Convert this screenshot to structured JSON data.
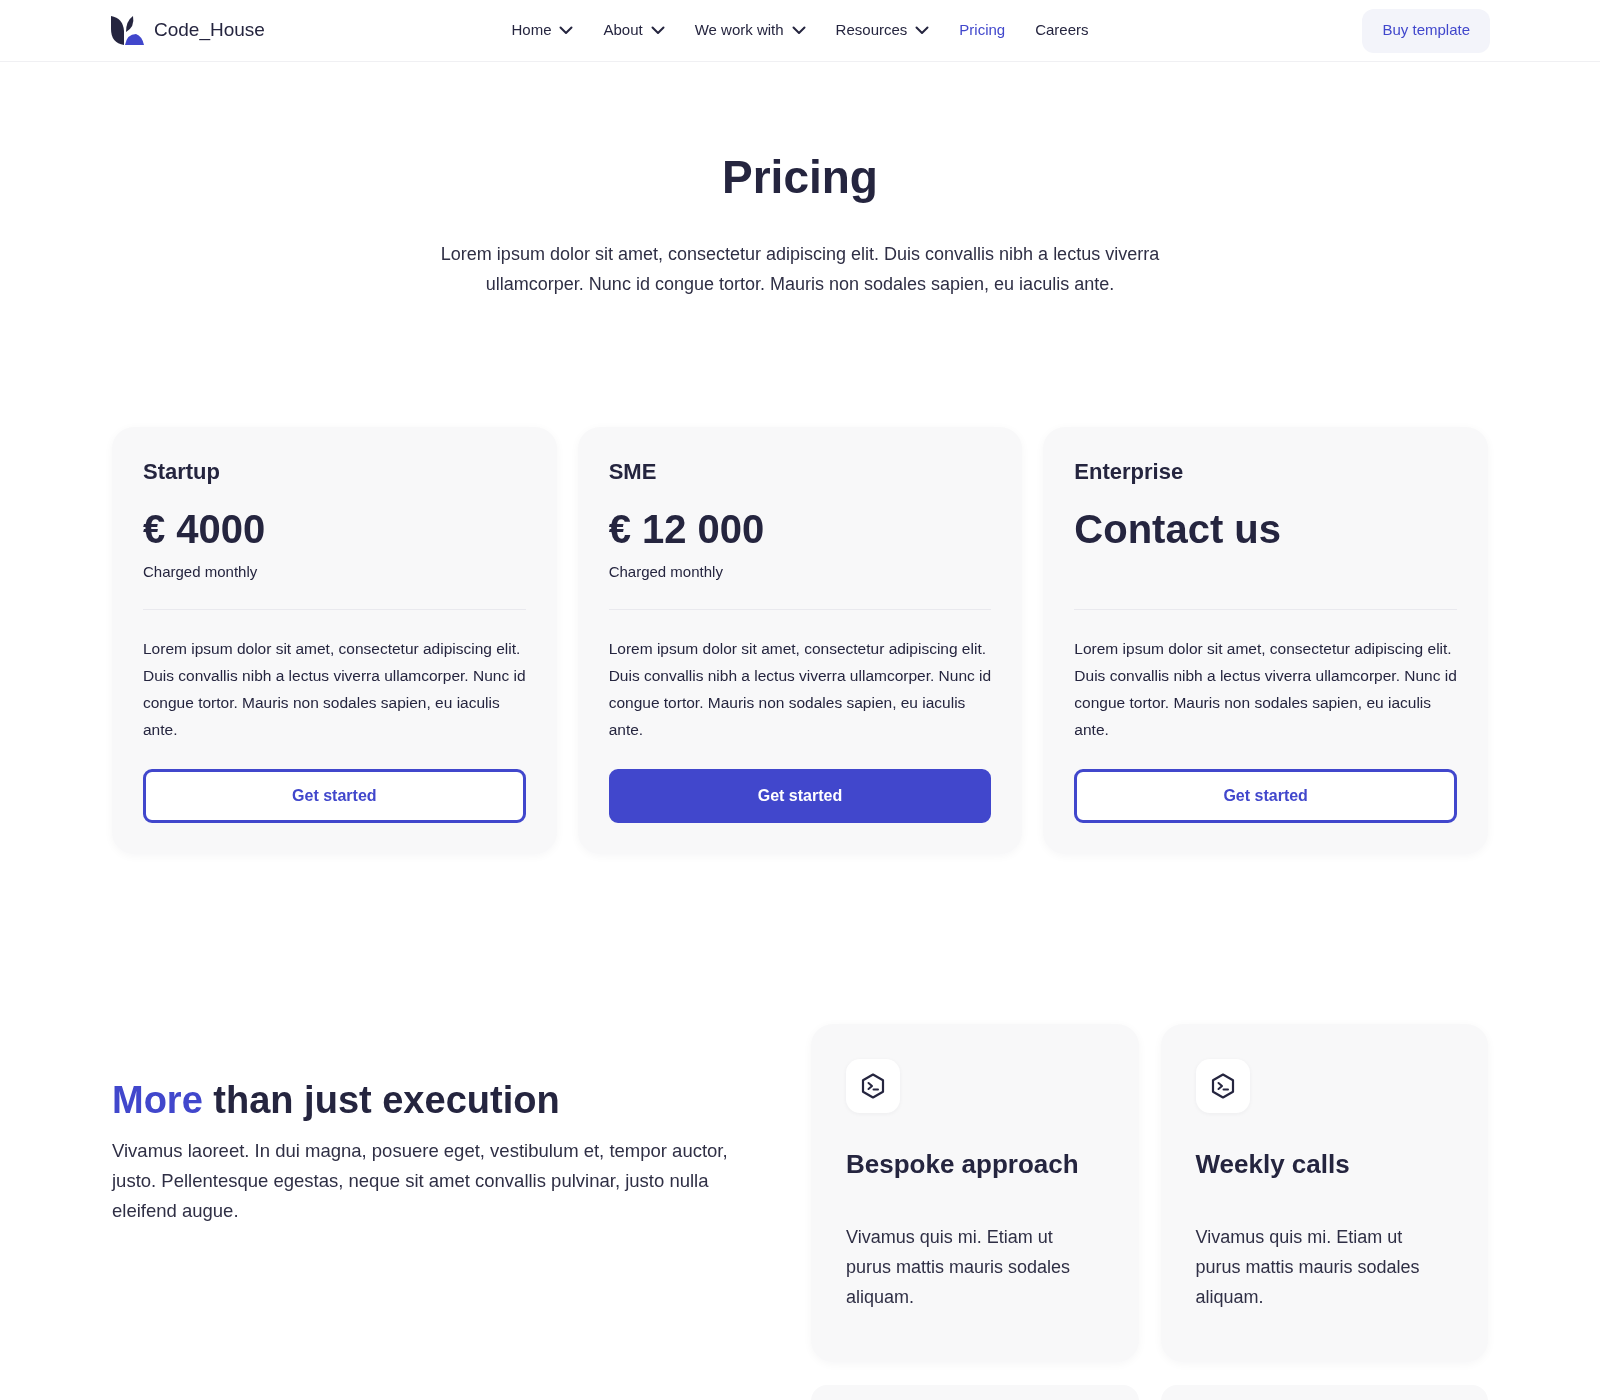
{
  "header": {
    "logo": "Code_House",
    "nav": [
      {
        "label": "Home",
        "dropdown": true,
        "selected": false
      },
      {
        "label": "About",
        "dropdown": true,
        "selected": false
      },
      {
        "label": "We work with",
        "dropdown": true,
        "selected": false
      },
      {
        "label": "Resources",
        "dropdown": true,
        "selected": false
      },
      {
        "label": "Pricing",
        "dropdown": false,
        "selected": true
      },
      {
        "label": "Careers",
        "dropdown": false,
        "selected": false
      }
    ],
    "cta": "Buy template"
  },
  "hero": {
    "title": "Pricing",
    "subtitle": "Lorem ipsum dolor sit amet, consectetur adipiscing elit. Duis convallis nibh a lectus viverra ullamcorper. Nunc id congue tortor. Mauris non sodales sapien, eu iaculis ante."
  },
  "plans": [
    {
      "name": "Startup",
      "price": "€ 4000",
      "billing": "Charged monthly",
      "description": "Lorem ipsum dolor sit amet, consectetur adipiscing elit. Duis convallis nibh a lectus viverra ullamcorper. Nunc id congue tortor. Mauris non sodales sapien, eu iaculis ante.",
      "button": "Get started",
      "featured": false
    },
    {
      "name": "SME",
      "price": "€ 12 000",
      "billing": "Charged monthly",
      "description": "Lorem ipsum dolor sit amet, consectetur adipiscing elit. Duis convallis nibh a lectus viverra ullamcorper. Nunc id congue tortor. Mauris non sodales sapien, eu iaculis ante.",
      "button": "Get started",
      "featured": true
    },
    {
      "name": "Enterprise",
      "price": "Contact us",
      "description": "Lorem ipsum dolor sit amet, consectetur adipiscing elit. Duis convallis nibh a lectus viverra ullamcorper. Nunc id congue tortor. Mauris non sodales sapien, eu iaculis ante.",
      "button": "Get started",
      "featured": false
    }
  ],
  "features": {
    "title_highlight": "More",
    "title": "than just execution",
    "text": "Vivamus laoreet. In dui magna, posuere eget, vestibulum et, tempor auctor, justo. Pellentesque egestas, neque sit amet convallis pulvinar, justo nulla eleifend augue.",
    "cards": [
      {
        "title": "Bespoke approach",
        "text": "Vivamus quis mi. Etiam ut purus mattis mauris sodales aliquam."
      },
      {
        "title": "Weekly calls",
        "text": "Vivamus quis mi. Etiam ut purus mattis mauris sodales aliquam."
      }
    ]
  }
}
